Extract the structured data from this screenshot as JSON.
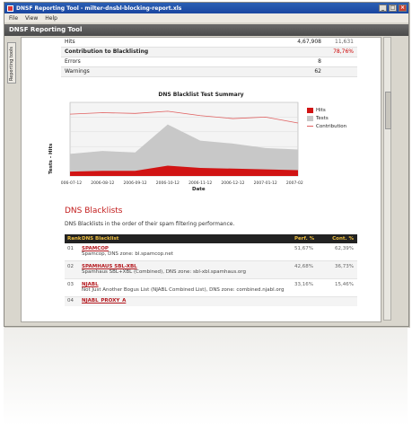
{
  "window": {
    "title": "DNSF Reporting Tool - milter-dnsbl-blocking-report.xls",
    "menu": [
      "File",
      "View",
      "Help"
    ]
  },
  "app": {
    "header": "DNSF Reporting Tool",
    "side_tab": "Reporting tools"
  },
  "stats": [
    {
      "label": "Hits",
      "v1": "4,67,908",
      "v2": "11,631",
      "bold": false
    },
    {
      "label": "Contribution to Blacklisting",
      "v1": "",
      "v2": "78,76%",
      "bold": true,
      "red": true
    },
    {
      "label": "Errors",
      "v1": "8",
      "v2": "",
      "bold": false
    },
    {
      "label": "Warnings",
      "v1": "62",
      "v2": "",
      "bold": false
    }
  ],
  "chart": {
    "title": "DNS Blacklist Test Summary",
    "ylabel": "Tests - Hits",
    "xlabel": "Date",
    "legend": [
      {
        "name": "Hits",
        "color": "#d11414"
      },
      {
        "name": "Tests",
        "color": "#c8c8c8"
      },
      {
        "name": "Contribution",
        "color": "#e06060"
      }
    ]
  },
  "chart_data": {
    "type": "area",
    "title": "DNS Blacklist Test Summary",
    "xlabel": "Date",
    "ylabel": "Tests - Hits",
    "x": [
      "2006-07-12",
      "2006-08-12",
      "2006-09-12",
      "2006-10-12",
      "2006-11-12",
      "2006-12-12",
      "2007-01-12",
      "2007-02-12"
    ],
    "series": [
      {
        "name": "Tests",
        "values": [
          30,
          34,
          32,
          70,
          48,
          44,
          38,
          36
        ]
      },
      {
        "name": "Hits",
        "values": [
          6,
          7,
          7,
          14,
          11,
          10,
          9,
          8
        ]
      },
      {
        "name": "Contribution",
        "values": [
          84,
          86,
          85,
          88,
          82,
          78,
          80,
          72
        ]
      }
    ],
    "grid": true,
    "legend_position": "right"
  },
  "section": {
    "title": "DNS Blacklists",
    "description": "DNS Blacklists in the order of their spam filtering performance."
  },
  "table": {
    "headers": {
      "rank": "Rank",
      "name": "DNS Blacklist",
      "perf": "Perf. %",
      "cont": "Cont. %"
    },
    "rows": [
      {
        "rank": "01",
        "name": "SPAMCOP",
        "desc": "Spamcop, DNS zone: bl.spamcop.net",
        "perf": "51,67%",
        "cont": "62,39%"
      },
      {
        "rank": "02",
        "name": "SPAMHAUS SBL-XBL",
        "desc": "Spamhaus SBL+XBL (Combined), DNS zone: sbl-xbl.spamhaus.org",
        "perf": "42,68%",
        "cont": "36,73%"
      },
      {
        "rank": "03",
        "name": "NJABL",
        "desc": "Not Just Another Bogus List (NJABL Combined List), DNS zone: combined.njabl.org",
        "perf": "33,16%",
        "cont": "15,46%"
      },
      {
        "rank": "04",
        "name": "NJABL_PROXY_A",
        "desc": "",
        "perf": "",
        "cont": ""
      }
    ]
  }
}
